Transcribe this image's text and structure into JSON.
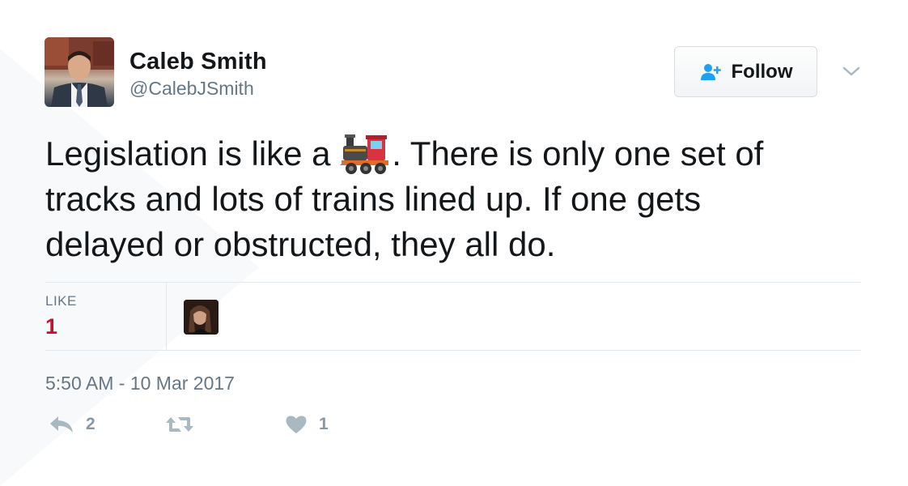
{
  "user": {
    "name": "Caleb Smith",
    "handle": "@CalebJSmith"
  },
  "follow_button": {
    "label": "Follow"
  },
  "tweet": {
    "lines": [
      {
        "before": "Legislation is like a ",
        "emoji": "locomotive-emoji",
        "after": ". There is only one set of"
      },
      {
        "text": "tracks and lots of trains lined up. If one gets"
      },
      {
        "text": "delayed or obstructed, they all do."
      }
    ]
  },
  "stats": {
    "like_label": "LIKE",
    "like_count": "1"
  },
  "timestamp": "5:50 AM - 10 Mar 2017",
  "actions": {
    "reply_count": "2",
    "like_count": "1"
  },
  "colors": {
    "like_count": "#c8102e",
    "follow_icon": "#1da1f2",
    "action_icon": "#aab8c2"
  }
}
